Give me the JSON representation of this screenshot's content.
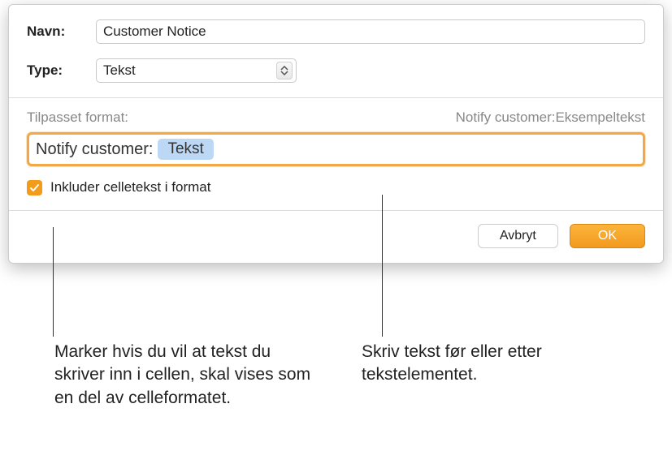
{
  "labels": {
    "name": "Navn:",
    "type": "Type:"
  },
  "name_value": "Customer Notice",
  "type_value": "Tekst",
  "format": {
    "title": "Tilpasset format:",
    "preview": "Notify customer:Eksempeltekst",
    "prefix": "Notify customer: ",
    "token": "Tekst"
  },
  "checkbox": {
    "label": "Inkluder celletekst i format"
  },
  "buttons": {
    "cancel": "Avbryt",
    "ok": "OK"
  },
  "callouts": {
    "left": "Marker hvis du vil at tekst du skriver inn i cellen, skal vises som en del av celleformatet.",
    "right": "Skriv tekst før eller etter tekstelementet."
  }
}
